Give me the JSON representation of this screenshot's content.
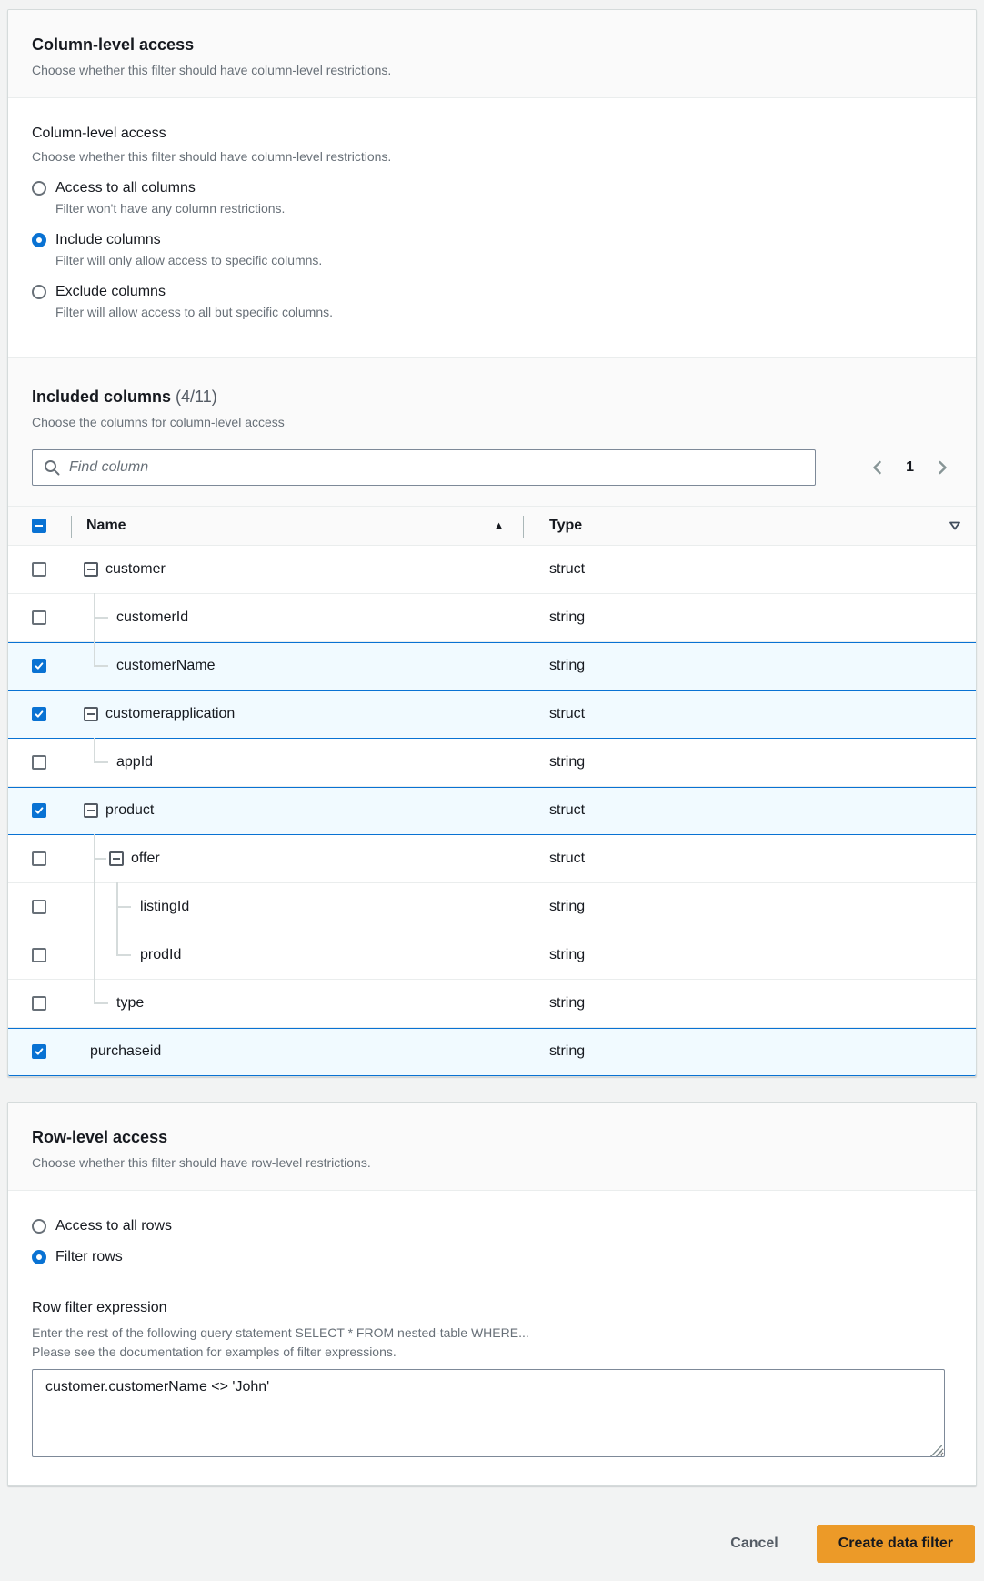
{
  "colors": {
    "accent_blue": "#0972d3",
    "selected_row_bg": "#f1faff",
    "primary_button_bg": "#ec9a28",
    "page_bg": "#f2f3f3"
  },
  "column_card": {
    "title": "Column-level access",
    "description": "Choose whether this filter should have column-level restrictions.",
    "form_label": "Column-level access",
    "form_description": "Choose whether this filter should have column-level restrictions.",
    "options": [
      {
        "label": "Access to all columns",
        "description": "Filter won't have any column restrictions.",
        "selected": false
      },
      {
        "label": "Include columns",
        "description": "Filter will only allow access to specific columns.",
        "selected": true
      },
      {
        "label": "Exclude columns",
        "description": "Filter will allow access to all but specific columns.",
        "selected": false
      }
    ]
  },
  "included_columns": {
    "title": "Included columns",
    "counter": "(4/11)",
    "description": "Choose the columns for column-level access",
    "search": {
      "placeholder": "Find column",
      "icon": "search-icon"
    },
    "pagination": {
      "previous_icon": "chevron-left-icon",
      "page": "1",
      "next_icon": "chevron-right-icon"
    },
    "table": {
      "select_all_state": "indeterminate",
      "name_header": "Name",
      "type_header": "Type",
      "sort_icon": "sort-ascending-icon",
      "filter_icon": "caret-down-icon",
      "rows": [
        {
          "name": "customer",
          "type": "struct",
          "checked": false,
          "level": 0,
          "expandable": true
        },
        {
          "name": "customerId",
          "type": "string",
          "checked": false,
          "level": 1,
          "expandable": false
        },
        {
          "name": "customerName",
          "type": "string",
          "checked": true,
          "level": 1,
          "expandable": false
        },
        {
          "name": "customerapplication",
          "type": "struct",
          "checked": true,
          "level": 0,
          "expandable": true
        },
        {
          "name": "appId",
          "type": "string",
          "checked": false,
          "level": 1,
          "expandable": false
        },
        {
          "name": "product",
          "type": "struct",
          "checked": true,
          "level": 0,
          "expandable": true
        },
        {
          "name": "offer",
          "type": "struct",
          "checked": false,
          "level": 1,
          "expandable": true
        },
        {
          "name": "listingId",
          "type": "string",
          "checked": false,
          "level": 2,
          "expandable": false
        },
        {
          "name": "prodId",
          "type": "string",
          "checked": false,
          "level": 2,
          "expandable": false
        },
        {
          "name": "type",
          "type": "string",
          "checked": false,
          "level": 1,
          "expandable": false
        },
        {
          "name": "purchaseid",
          "type": "string",
          "checked": true,
          "level": 0,
          "expandable": false
        }
      ]
    }
  },
  "row_card": {
    "title": "Row-level access",
    "description": "Choose whether this filter should have row-level restrictions.",
    "options": [
      {
        "label": "Access to all rows",
        "selected": false
      },
      {
        "label": "Filter rows",
        "selected": true
      }
    ],
    "expression": {
      "label": "Row filter expression",
      "hint_line1": "Enter the rest of the following query statement SELECT * FROM nested-table WHERE...",
      "hint_line2": "Please see the documentation for examples of filter expressions.",
      "value": "customer.customerName <> 'John'"
    }
  },
  "footer": {
    "cancel_label": "Cancel",
    "create_label": "Create data filter"
  }
}
